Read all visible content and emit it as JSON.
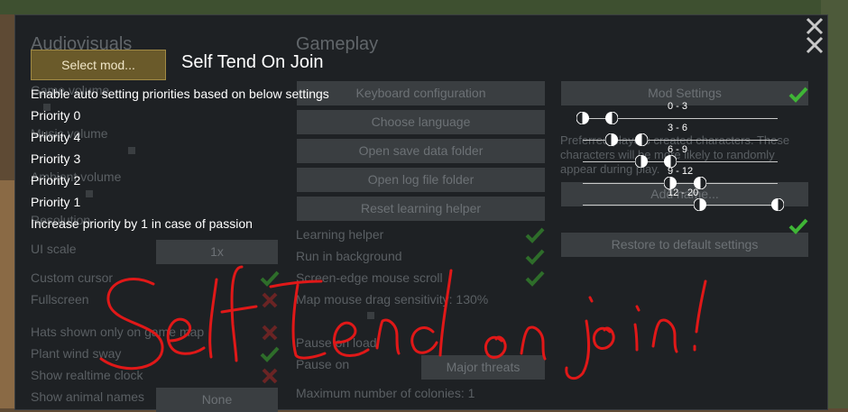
{
  "window": {
    "close_icon_top": "close-icon",
    "close_icon_second": "close-icon"
  },
  "background_ui": {
    "audiovisuals_heading": "Audiovisuals",
    "gameplay_heading": "Gameplay",
    "game_volume": "Game volume",
    "music_volume": "Music volume",
    "ambient_volume": "Ambient volume",
    "resolution": "Resolution",
    "ui_scale": "UI scale",
    "ui_scale_value": "1x",
    "custom_cursor": "Custom cursor",
    "fullscreen": "Fullscreen",
    "hats_shown": "Hats shown only on game map",
    "plant_wind_sway": "Plant wind sway",
    "show_realtime_clock": "Show realtime clock",
    "show_animal_names": "Show animal names",
    "show_animal_names_value": "None",
    "keyboard_configuration": "Keyboard configuration",
    "choose_language": "Choose language",
    "open_save_data_folder": "Open save data folder",
    "open_log_file_folder": "Open log file folder",
    "reset_learning_helper": "Reset learning helper",
    "learning_helper": "Learning helper",
    "run_in_background": "Run in background",
    "screen_edge_scroll": "Screen-edge mouse scroll",
    "map_drag_sensitivity": "Map mouse drag sensitivity: 130%",
    "pause_on_load": "Pause on load",
    "pause_on": "Pause on",
    "pause_on_value": "Major threats",
    "max_colonies": "Maximum number of colonies: 1",
    "mod_settings": "Mod Settings",
    "preferred_players": "Preferred players created characters. These characters will be more likely to randomly appear during play.",
    "add_name": "Add name...",
    "restore_defaults": "Restore to default settings"
  },
  "dialog": {
    "select_mod_label": "Select mod...",
    "title": "Self Tend On Join",
    "auto_priorities_label": "Enable auto setting priorities based on below settings",
    "priorities": [
      "Priority 0",
      "Priority 4",
      "Priority 3",
      "Priority 2",
      "Priority 1"
    ],
    "passion_label": "Increase priority by 1 in case of passion",
    "ranges": [
      {
        "label": "0 - 3",
        "min": 0,
        "max": 3
      },
      {
        "label": "3 - 6",
        "min": 3,
        "max": 6
      },
      {
        "label": "6 - 9",
        "min": 6,
        "max": 9
      },
      {
        "label": "9 - 12",
        "min": 9,
        "max": 12
      },
      {
        "label": "12 - 20",
        "min": 12,
        "max": 20
      }
    ],
    "auto_priorities_enabled": true,
    "passion_enabled": true
  },
  "overlay": {
    "handwriting": "Self tend on join!"
  },
  "colors": {
    "check_green": "#3fb536",
    "cross_red": "#b03030",
    "scribble_red": "#e01818",
    "select_mod_bg": "#6a5a2a"
  }
}
